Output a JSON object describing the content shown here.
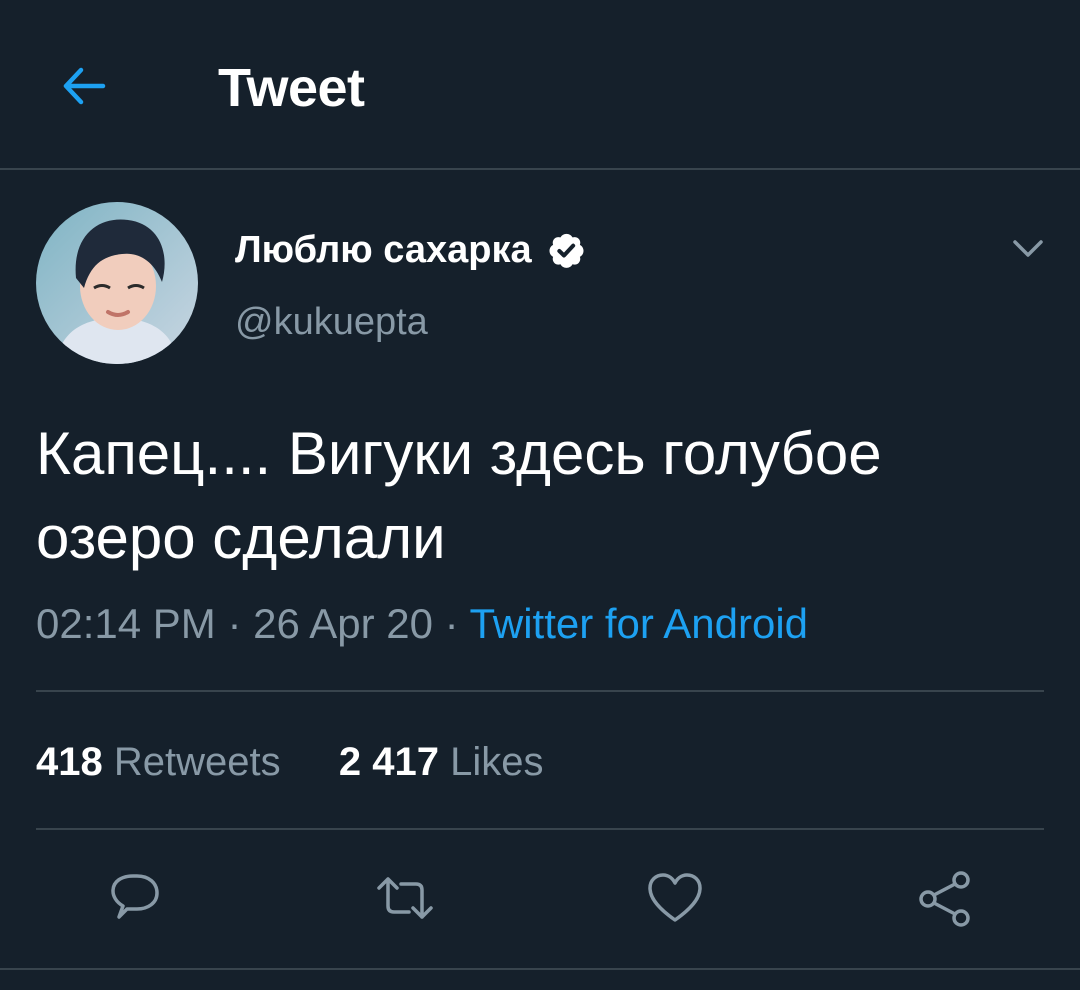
{
  "header": {
    "title": "Tweet"
  },
  "user": {
    "display_name": "Люблю сахарка",
    "handle": "@kukuepta"
  },
  "tweet": {
    "text_line1": "Капец.... Вигуки здесь голубое",
    "text_line2": "озеро сделали",
    "time": "02:14 PM",
    "date": "26 Apr 20",
    "separator": "·",
    "source": "Twitter for Android"
  },
  "stats": {
    "retweets_count": "418",
    "retweets_label": "Retweets",
    "likes_count": "2 417",
    "likes_label": "Likes"
  },
  "icons": {
    "back": "arrow-left-icon",
    "verified": "verified-badge-icon",
    "caret": "chevron-down-icon",
    "reply": "reply-icon",
    "retweet": "retweet-icon",
    "like": "heart-icon",
    "share": "share-icon"
  },
  "colors": {
    "background": "#15202b",
    "accent": "#1da1f2",
    "secondary_text": "#8899a6",
    "divider": "#38444d"
  }
}
